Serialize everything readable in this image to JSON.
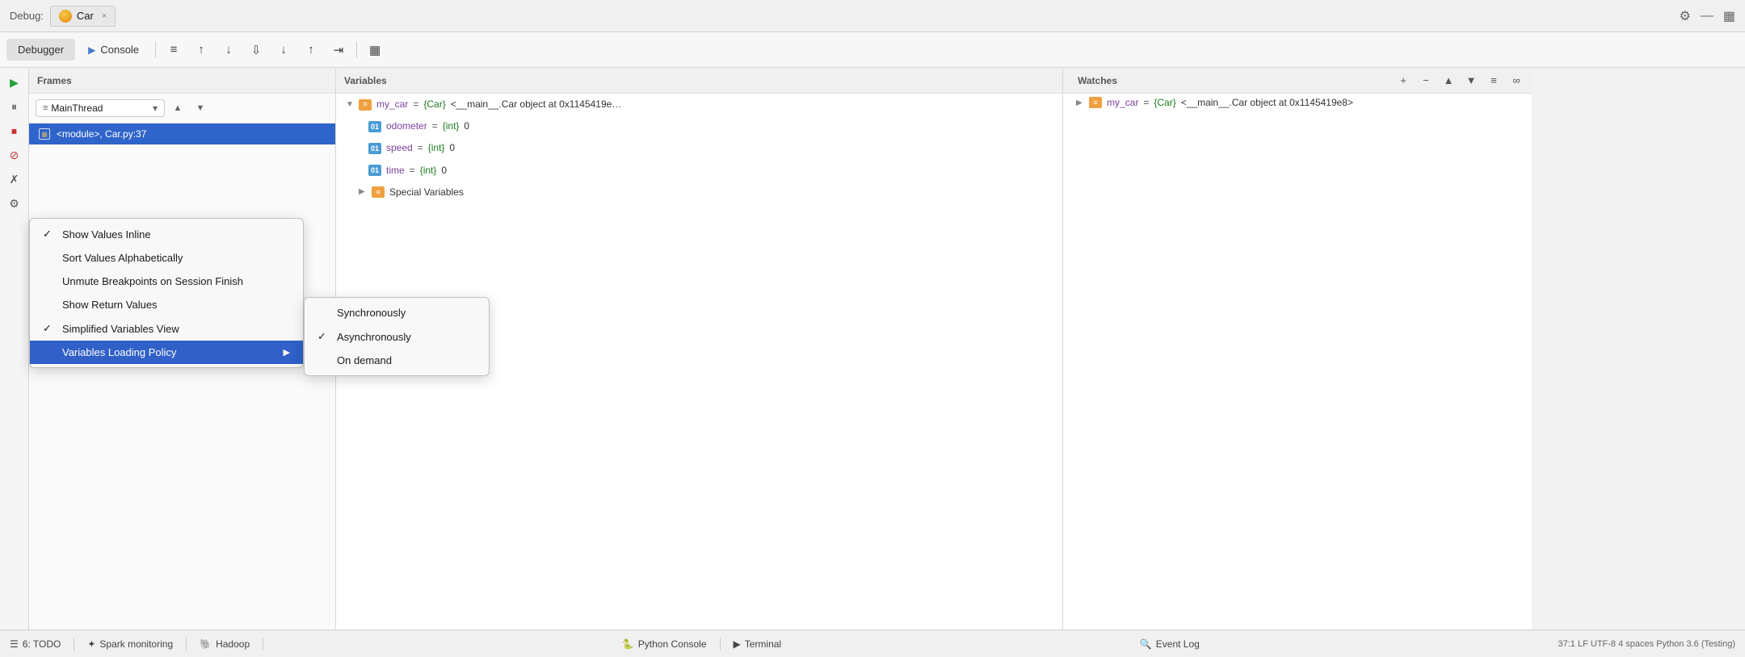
{
  "titlebar": {
    "label": "Debug:",
    "tab_name": "Car",
    "close_label": "×",
    "gear_icon": "⚙",
    "minimize_icon": "—",
    "layout_icon": "▦"
  },
  "toolbar": {
    "debugger_label": "Debugger",
    "console_label": "Console",
    "buttons": [
      "≡",
      "↑",
      "↓",
      "⇩",
      "↓",
      "↑",
      "⇥",
      "▦"
    ]
  },
  "frames_panel": {
    "header": "Frames",
    "thread": "MainThread",
    "frame": "<module>, Car.py:37"
  },
  "variables_panel": {
    "header": "Variables",
    "rows": [
      {
        "icon_type": "orange",
        "icon_label": "≡",
        "name": "my_car",
        "eq": " = ",
        "type": "{Car}",
        "value": " <__main__.Car object at 0x1145419e…",
        "indent": 0,
        "arrow": "▼",
        "expanded": true
      },
      {
        "icon_type": "blue",
        "icon_label": "01",
        "name": "odometer",
        "eq": " = ",
        "type": "{int}",
        "value": " 0",
        "indent": 1,
        "arrow": ""
      },
      {
        "icon_type": "blue",
        "icon_label": "01",
        "name": "speed",
        "eq": " = ",
        "type": "{int}",
        "value": " 0",
        "indent": 1,
        "arrow": ""
      },
      {
        "icon_type": "blue",
        "icon_label": "01",
        "name": "time",
        "eq": " = ",
        "type": "{int}",
        "value": " 0",
        "indent": 1,
        "arrow": ""
      },
      {
        "icon_type": "orange",
        "icon_label": "≡",
        "name": "Special Variables",
        "eq": "",
        "type": "",
        "value": "",
        "indent": 1,
        "arrow": "▶"
      }
    ]
  },
  "watches_panel": {
    "header": "Watches",
    "buttons": [
      "+",
      "−",
      "▲",
      "▼",
      "≡",
      "∞"
    ],
    "rows": [
      {
        "arrow": "▶",
        "icon_type": "orange",
        "icon_label": "≡",
        "name": "my_car",
        "eq": " = ",
        "type": "{Car}",
        "value": " <__main__.Car object at 0x1145419e8>"
      }
    ]
  },
  "context_menu": {
    "items": [
      {
        "check": "✓",
        "label": "Show Values Inline",
        "arrow": ""
      },
      {
        "check": "",
        "label": "Sort Values Alphabetically",
        "arrow": ""
      },
      {
        "check": "",
        "label": "Unmute Breakpoints on Session Finish",
        "arrow": ""
      },
      {
        "check": "",
        "label": "Show Return Values",
        "arrow": ""
      },
      {
        "check": "✓",
        "label": "Simplified Variables View",
        "arrow": ""
      },
      {
        "check": "",
        "label": "Variables Loading Policy",
        "arrow": "▶",
        "highlighted": true
      }
    ]
  },
  "submenu": {
    "items": [
      {
        "check": "",
        "label": "Synchronously"
      },
      {
        "check": "✓",
        "label": "Asynchronously"
      },
      {
        "check": "",
        "label": "On demand"
      }
    ]
  },
  "status_bar": {
    "items": [
      {
        "icon": "☰",
        "label": "6: TODO"
      },
      {
        "icon": "✦",
        "label": "Spark monitoring"
      },
      {
        "icon": "🐘",
        "label": "Hadoop"
      },
      {
        "icon": "🐍",
        "label": "Python Console"
      },
      {
        "icon": "▶",
        "label": "Terminal"
      },
      {
        "icon": "🔍",
        "label": "Event Log"
      }
    ],
    "right_info": "37:1  LF  UTF-8  4 spaces  Python 3.6 (Testing)"
  }
}
